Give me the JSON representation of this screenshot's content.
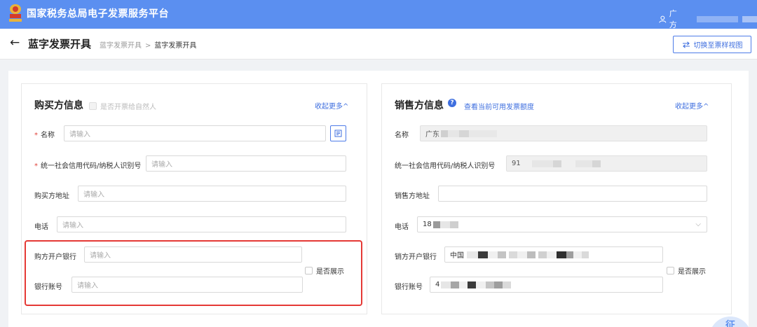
{
  "app": {
    "title": "国家税务总局电子发票服务平台",
    "user_name": "广方",
    "brand_color": "#5b8ff0",
    "accent_color": "#3f6fdf",
    "required_color": "#e0433b",
    "highlight_color": "#e53935"
  },
  "header": {
    "page_title": "蓝字发票开具",
    "breadcrumb": [
      "蓝字发票开具",
      "蓝字发票开具"
    ],
    "breadcrumb_separator": ">",
    "switch_label": "切换至票样视图"
  },
  "buyer": {
    "title": "购买方信息",
    "natural_person_label": "是否开票给自然人",
    "natural_person_checked": false,
    "collapse_label": "收起更多^",
    "fields": {
      "name": {
        "label": "名称",
        "required": true,
        "placeholder": "请输入"
      },
      "tax_id": {
        "label": "统一社会信用代码/纳税人识别号",
        "required": true,
        "placeholder": "请输入"
      },
      "address": {
        "label": "购买方地址",
        "placeholder": "请输入"
      },
      "phone": {
        "label": "电话",
        "placeholder": "请输入"
      },
      "bank": {
        "label": "购方开户银行",
        "placeholder": "请输入"
      },
      "account": {
        "label": "银行账号",
        "placeholder": "请输入"
      }
    },
    "show_toggle_label": "是否展示",
    "show_toggle_checked": false
  },
  "seller": {
    "title": "销售方信息",
    "info_icon": "question-circle-icon",
    "quota_link": "查看当前可用发票额度",
    "collapse_label": "收起更多^",
    "fields": {
      "name": {
        "label": "名称",
        "value": "广东"
      },
      "tax_id": {
        "label": "统一社会信用代码/纳税人识别号",
        "value": "91"
      },
      "address": {
        "label": "销售方地址",
        "value": ""
      },
      "phone": {
        "label": "电话",
        "value": "18"
      },
      "bank": {
        "label": "销方开户银行",
        "value": "中国"
      },
      "account": {
        "label": "银行账号",
        "value": "4"
      }
    },
    "show_toggle_label": "是否展示",
    "show_toggle_checked": false
  },
  "decor": {
    "seal_text": "征"
  }
}
